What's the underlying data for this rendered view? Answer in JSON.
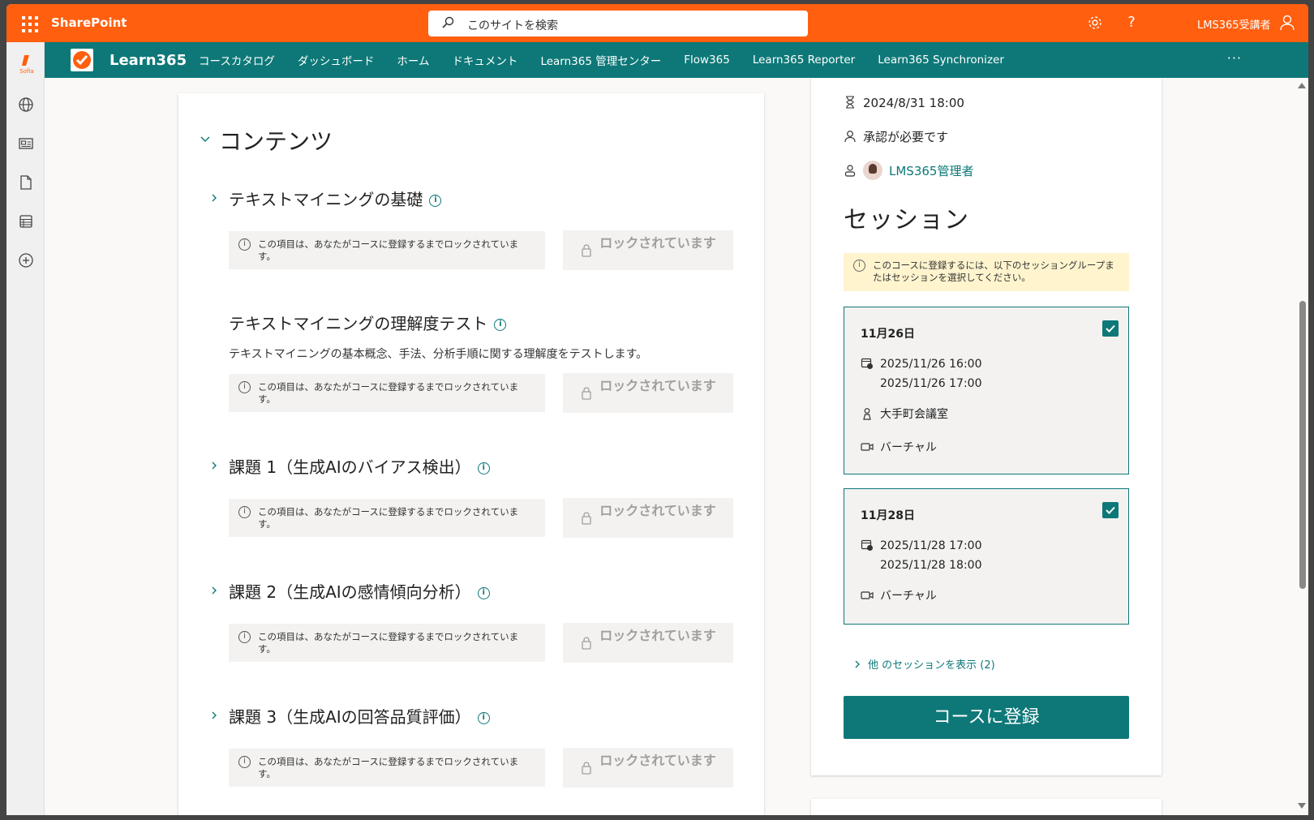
{
  "suite": {
    "app_name": "SharePoint",
    "search_placeholder": "このサイトを検索",
    "user_name": "LMS365受講者",
    "help_glyph": "?"
  },
  "appbar": {
    "logo_text": "Sofia",
    "icons": [
      "globe-icon",
      "news-icon",
      "file-icon",
      "list-icon",
      "add-icon"
    ]
  },
  "hubnav": {
    "brand": "Learn365",
    "links": [
      "コースカタログ",
      "ダッシュボード",
      "ホーム",
      "ドキュメント",
      "Learn365 管理センター",
      "Flow365",
      "Learn365 Reporter",
      "Learn365 Synchronizer"
    ],
    "more": "···"
  },
  "contents": {
    "title": "コンテンツ",
    "lock_note": "この項目は、あなたがコースに登録するまでロックされています。",
    "lock_label": "ロックされています",
    "items": [
      {
        "title": "テキストマイニングの基礎",
        "desc": ""
      },
      {
        "title": "テキストマイニングの理解度テスト",
        "desc": "テキストマイニングの基本概念、手法、分析手順に関する理解度をテストします。"
      },
      {
        "title": "課題 1（生成AIのバイアス検出）",
        "desc": ""
      },
      {
        "title": "課題 2（生成AIの感情傾向分析）",
        "desc": ""
      },
      {
        "title": "課題 3（生成AIの回答品質評価）",
        "desc": ""
      }
    ]
  },
  "side": {
    "deadline": "2024/8/31 18:00",
    "approval": "承認が必要です",
    "owner": "LMS365管理者",
    "sessions_title": "セッション",
    "warning": "このコースに登録するには、以下のセッショングループまたはセッションを選択してください。",
    "sessions": [
      {
        "date_label": "11月26日",
        "start": "2025/11/26 16:00",
        "end": "2025/11/26 17:00",
        "location": "大手町会議室",
        "type": "バーチャル",
        "checked": true
      },
      {
        "date_label": "11月28日",
        "start": "2025/11/28 17:00",
        "end": "2025/11/28 18:00",
        "location": "",
        "type": "バーチャル",
        "checked": true
      }
    ],
    "more_sessions": "他 のセッションを表示 (2)",
    "enroll": "コースに登録"
  },
  "colors": {
    "suite_bar": "#ff5f0f",
    "hub_nav": "#0e7878",
    "warning_bg": "#fff4ce"
  }
}
